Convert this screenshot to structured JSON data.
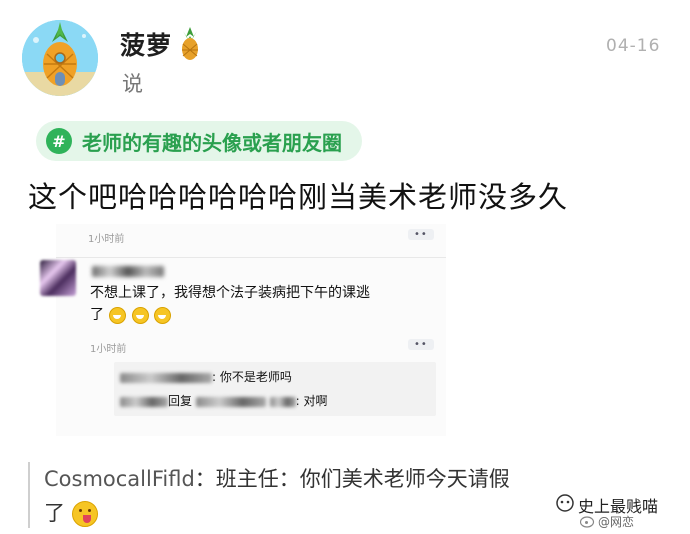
{
  "post": {
    "author": "菠萝",
    "says": "说",
    "date": "04-16",
    "topic": "老师的有趣的头像或者朋友圈",
    "topic_icon": "#",
    "headline": "这个吧哈哈哈哈哈哈刚当美术老师没多久"
  },
  "screenshot": {
    "top_time": "1小时前",
    "top_dots": "••",
    "post_line1": "不想上课了，我得想个法子装病把下午的课逃",
    "post_line2": "了",
    "post_time": "1小时前",
    "post_dots": "••",
    "comment1_tail": ": 你不是老师吗",
    "comment2_reply": "回复",
    "comment2_tail": ": 对啊"
  },
  "comment": {
    "user": "CosmocallFifld",
    "sep": "：",
    "text": "班主任：你们美术老师今天请假",
    "text2": "了"
  },
  "watermark": {
    "line1": "史上最贱喵",
    "line2": "@网恋"
  }
}
